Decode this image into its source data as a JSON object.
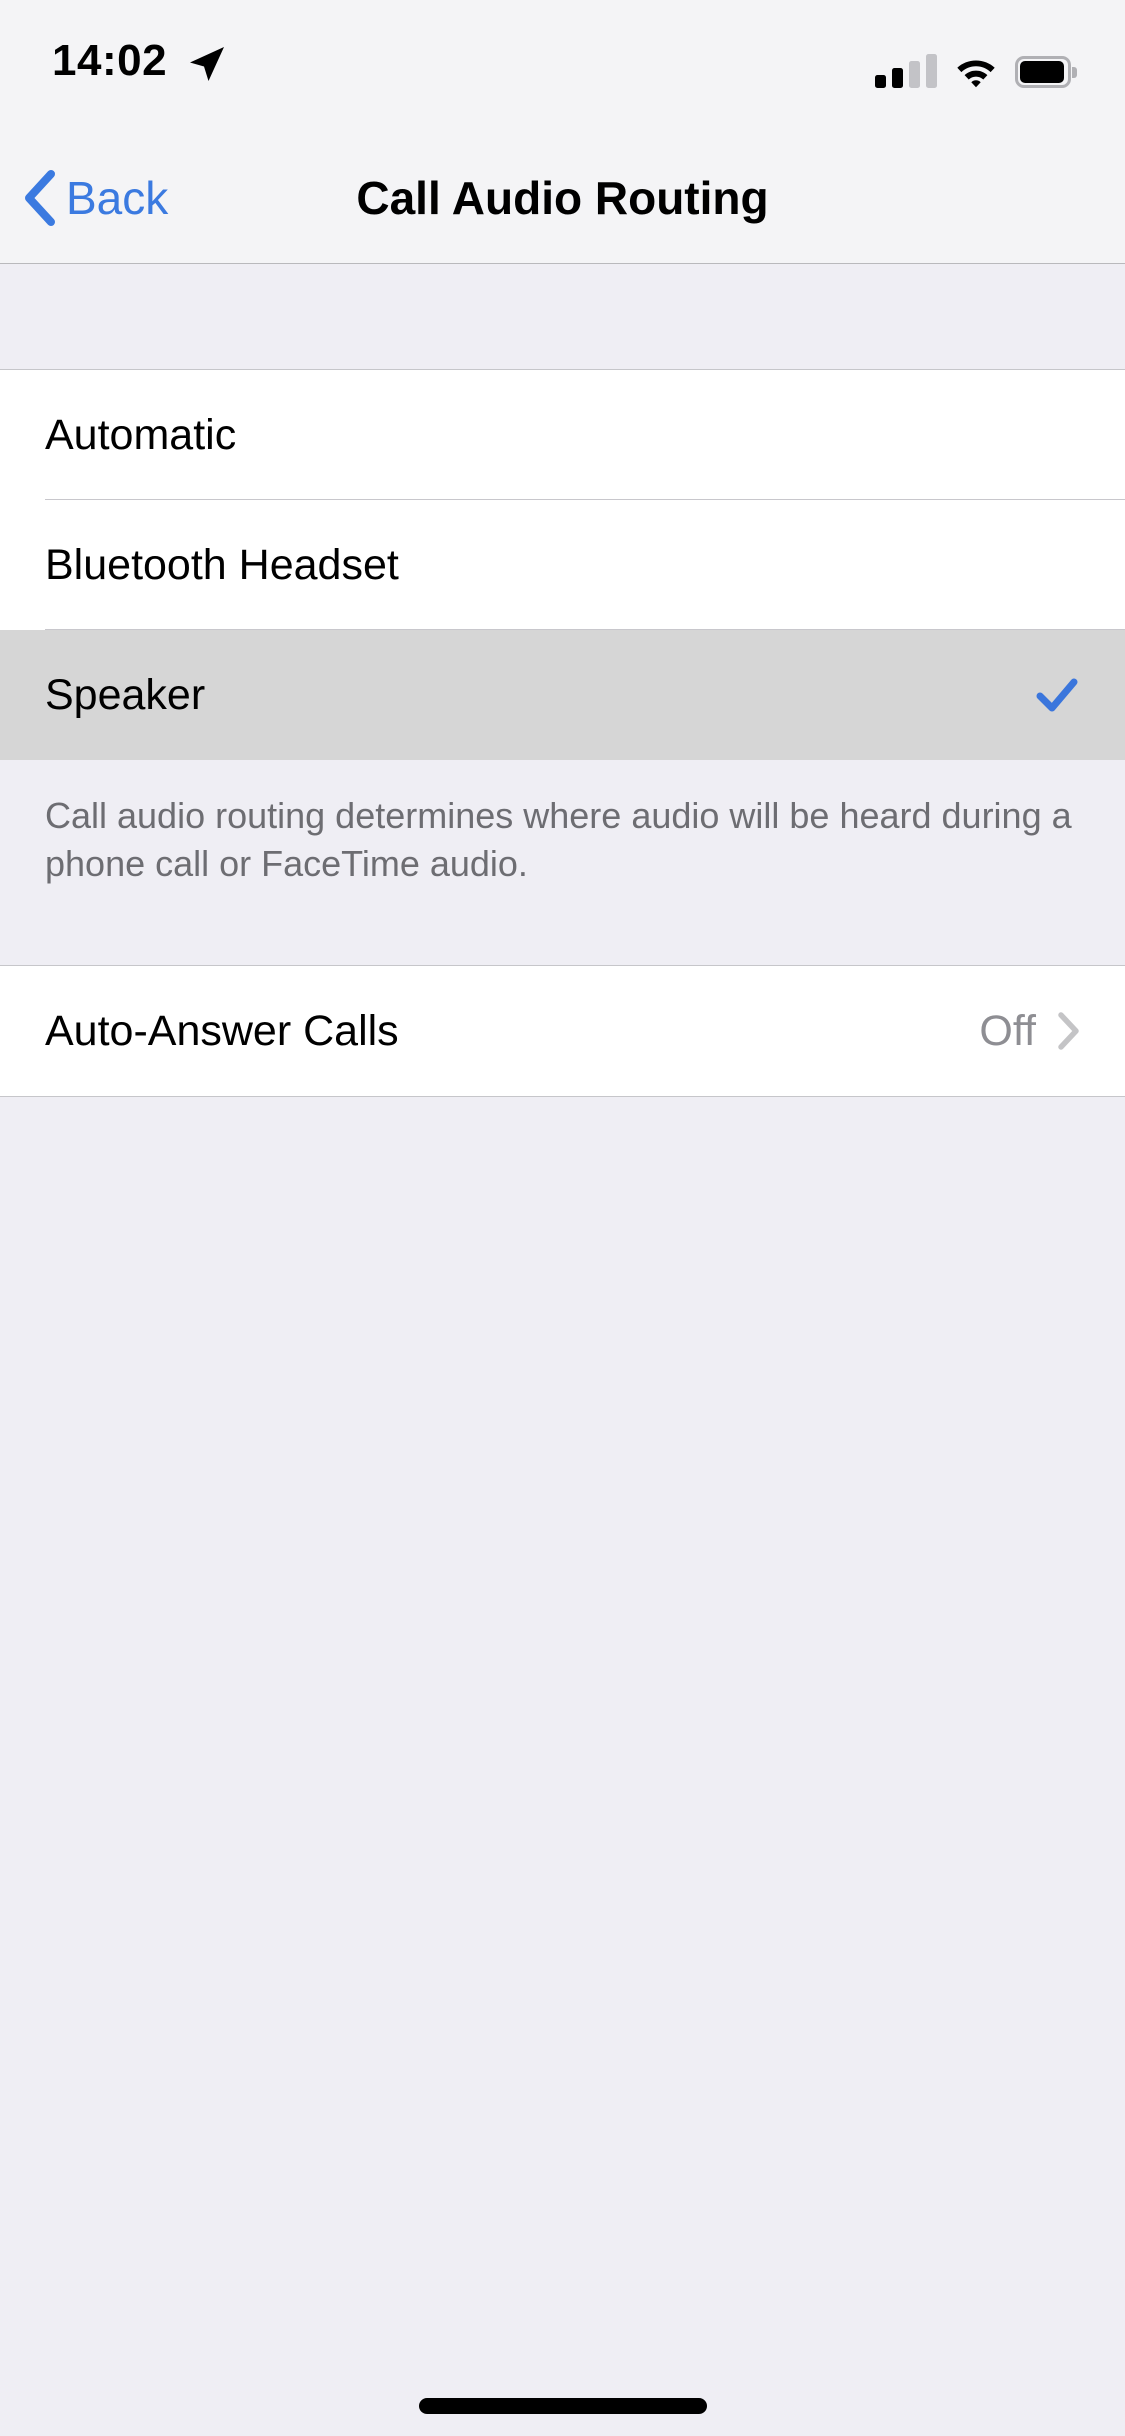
{
  "status_bar": {
    "time": "14:02",
    "location_icon": "location-arrow-icon",
    "cellular_icon": "cellular-signal-icon",
    "cellular_bars_filled": 2,
    "cellular_bars_total": 4,
    "wifi_icon": "wifi-icon",
    "battery_icon": "battery-icon"
  },
  "nav": {
    "back_label": "Back",
    "back_icon": "chevron-left-icon",
    "title": "Call Audio Routing"
  },
  "routing_section": {
    "options": [
      {
        "label": "Automatic",
        "selected": false
      },
      {
        "label": "Bluetooth Headset",
        "selected": false
      },
      {
        "label": "Speaker",
        "selected": true
      }
    ],
    "checkmark_icon": "checkmark-icon",
    "footer": "Call audio routing determines where audio will be heard during a phone call or FaceTime audio."
  },
  "auto_answer_section": {
    "rows": [
      {
        "label": "Auto-Answer Calls",
        "value": "Off",
        "disclosure_icon": "chevron-right-icon"
      }
    ]
  },
  "home_indicator": "home-indicator",
  "colors": {
    "accent_blue": "#3B7AE0",
    "checkmark_blue": "#3B76DC",
    "page_background": "#EFEEF4",
    "row_background": "#FFFFFF",
    "selected_row_background": "#D6D6D6",
    "secondary_text": "#8E8E93",
    "footer_text": "#6D6D72",
    "separator": "#C8C7CC"
  }
}
